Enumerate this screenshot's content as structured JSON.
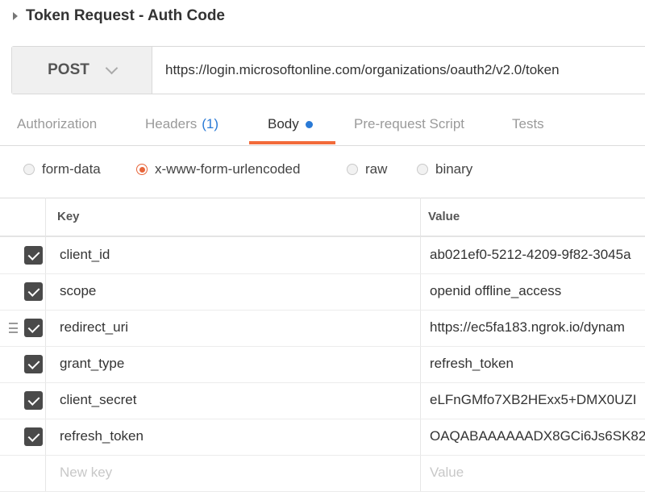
{
  "request": {
    "title": "Token Request - Auth Code",
    "method": "POST",
    "url": "https://login.microsoftonline.com/organizations/oauth2/v2.0/token"
  },
  "tabs": [
    {
      "label": "Authorization"
    },
    {
      "label": "Headers",
      "count": "(1)"
    },
    {
      "label": "Body",
      "active": true
    },
    {
      "label": "Pre-request Script"
    },
    {
      "label": "Tests"
    }
  ],
  "body_types": [
    {
      "label": "form-data",
      "selected": false
    },
    {
      "label": "x-www-form-urlencoded",
      "selected": true
    },
    {
      "label": "raw",
      "selected": false
    },
    {
      "label": "binary",
      "selected": false
    }
  ],
  "table": {
    "key_header": "Key",
    "value_header": "Value",
    "rows": [
      {
        "key": "client_id",
        "value": "ab021ef0-5212-4209-9f82-3045a",
        "checked": true
      },
      {
        "key": "scope",
        "value": "openid offline_access",
        "checked": true
      },
      {
        "key": "redirect_uri",
        "value": "https://ec5fa183.ngrok.io/dynam",
        "checked": true
      },
      {
        "key": "grant_type",
        "value": "refresh_token",
        "checked": true
      },
      {
        "key": "client_secret",
        "value": "eLFnGMfo7XB2HExx5+DMX0UZI",
        "checked": true
      },
      {
        "key": "refresh_token",
        "value": "OAQABAAAAAADX8GCi6Js6SK82",
        "checked": true
      }
    ],
    "new_key_placeholder": "New key",
    "new_value_placeholder": "Value"
  },
  "colors": {
    "accent": "#f26b3a",
    "link": "#2a7ad6",
    "checkbox": "#4a4a4a"
  }
}
